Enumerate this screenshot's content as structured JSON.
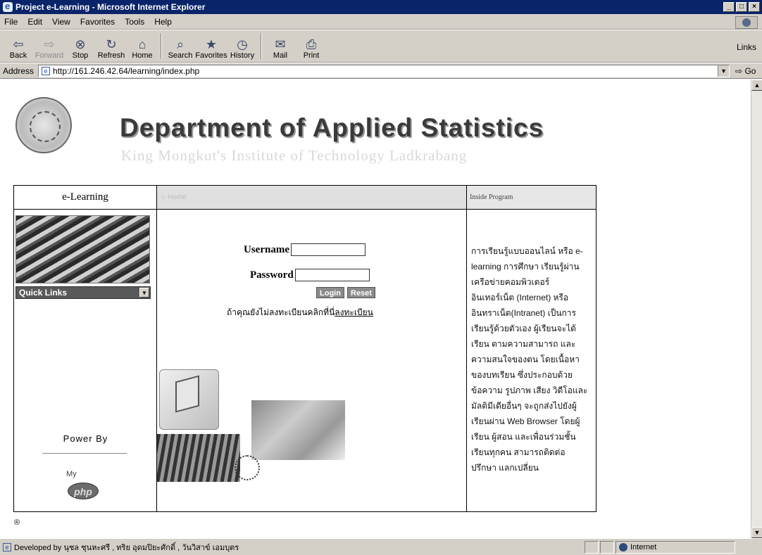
{
  "window": {
    "title": "Project e-Learning - Microsoft Internet Explorer",
    "controls": [
      "_",
      "□",
      "×"
    ]
  },
  "menu": [
    "File",
    "Edit",
    "View",
    "Favorites",
    "Tools",
    "Help"
  ],
  "toolbar": {
    "buttons": [
      {
        "label": "Back",
        "icon": "back-arrow-icon",
        "glyph": "⇦"
      },
      {
        "label": "Forward",
        "icon": "forward-arrow-icon",
        "glyph": "⇨"
      },
      {
        "label": "Stop",
        "icon": "stop-icon",
        "glyph": "⊗"
      },
      {
        "label": "Refresh",
        "icon": "refresh-icon",
        "glyph": "↻"
      },
      {
        "label": "Home",
        "icon": "home-icon",
        "glyph": "⌂"
      },
      {
        "label": "Search",
        "icon": "search-icon",
        "glyph": "⌕"
      },
      {
        "label": "Favorites",
        "icon": "favorites-icon",
        "glyph": "★"
      },
      {
        "label": "History",
        "icon": "history-icon",
        "glyph": "◷"
      },
      {
        "label": "Mail",
        "icon": "mail-icon",
        "glyph": "✉"
      },
      {
        "label": "Print",
        "icon": "print-icon",
        "glyph": "⎙"
      }
    ],
    "links_label": "Links"
  },
  "address": {
    "label": "Address",
    "url": "http://161.246.42.64/learning/index.php",
    "go_label": "Go"
  },
  "page": {
    "dept_title": "Department of Applied Statistics",
    "institute": "King Mongkut's Institute of Technology Ladkrabang",
    "nav_left": "e-Learning",
    "nav_mid": "Home",
    "nav_right": "Inside Program",
    "quick_links": "Quick Links",
    "username_label": "Username",
    "password_label": "Password",
    "login_button": "Login",
    "reset_button": "Reset",
    "register_prefix": "ถ้าคุณยังไม่ลงทะเบียนคลิกที่นี่",
    "register_link": "ลงทะเบียน",
    "power_by": "Power By",
    "php_my": "My",
    "php_text": "php",
    "description": "การเรียนรู้แบบออนไลน์ หรือ e-learning การศึกษา เรียนรู้ผ่านเครือข่ายคอมพิวเตอร์ อินเทอร์เน็ต (Internet) หรืออินทราเน็ต(Intranet) เป็นการเรียนรู้ด้วยตัวเอง ผู้เรียนจะได้เรียน ตามความสามารถ และความสนใจของตน โดยเนื้อหาของบทเรียน ซึ่งประกอบด้วยข้อความ รูปภาพ เสียง วิดีโอและมัลติมีเดียอื่นๆ จะถูกส่งไปยังผู้เรียนผ่าน Web Browser โดยผู้เรียน ผู้สอน และเพื่อนร่วมชั้นเรียนทุกคน สามารถติดต่อ ปรึกษา แลกเปลี่ยน",
    "registered_mark": "®"
  },
  "status": {
    "text": "Developed by นุชล ชุนหะศรี , ทริย อุดมปิยะศักดิ์ , วันวิสาข์ เอมบุตร",
    "zone": "Internet"
  }
}
